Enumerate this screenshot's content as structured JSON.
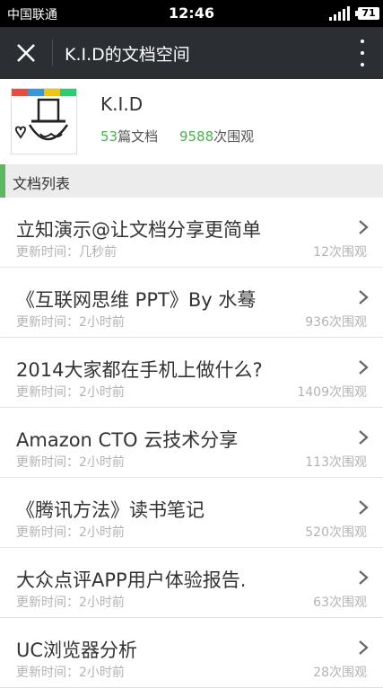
{
  "status_bar": {
    "carrier": "中国联通",
    "time": "12:46",
    "battery": "71"
  },
  "topbar": {
    "title": "K.I.D的文档空间"
  },
  "profile": {
    "name": "K.I.D",
    "docs_count": "53",
    "docs_suffix": "篇文档",
    "views_count": "9588",
    "views_suffix": "次围观"
  },
  "section": {
    "label": "文档列表"
  },
  "documents": [
    {
      "title": "立知演示@让文档分享更简单",
      "updated": "更新时间：几秒前",
      "views": "12次围观"
    },
    {
      "title": "《互联网思维 PPT》By 水蓦",
      "updated": "更新时间：2小时前",
      "views": "936次围观"
    },
    {
      "title": "2014大家都在手机上做什么?",
      "updated": "更新时间：2小时前",
      "views": "1409次围观"
    },
    {
      "title": "Amazon CTO 云技术分享",
      "updated": "更新时间：2小时前",
      "views": "113次围观"
    },
    {
      "title": "《腾讯方法》读书笔记",
      "updated": "更新时间：2小时前",
      "views": "520次围观"
    },
    {
      "title": "大众点评APP用户体验报告.",
      "updated": "更新时间：2小时前",
      "views": "63次围观"
    },
    {
      "title": "UC浏览器分析",
      "updated": "更新时间：2小时前",
      "views": "28次围观"
    }
  ],
  "colors": {
    "accent": "#5cb85c",
    "count": "#4caf50",
    "topbar": "#2b2f33"
  }
}
